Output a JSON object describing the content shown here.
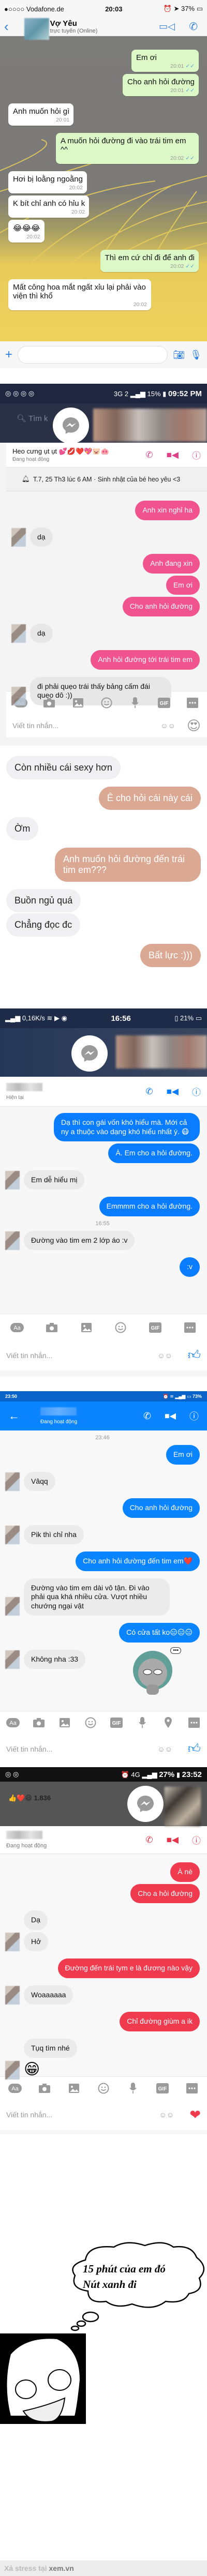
{
  "whatsapp": {
    "status": {
      "carrier": "●○○○○ Vodafone.de",
      "time": "20:03",
      "battery": "37%"
    },
    "contact": {
      "name": "Vợ Yêu",
      "status": "trực tuyến (Online)"
    },
    "messages": [
      {
        "side": "out",
        "text": "Em ơi",
        "time": "20:01"
      },
      {
        "side": "out",
        "text": "Cho anh hỏi đường",
        "time": "20:01"
      },
      {
        "side": "in",
        "text": "Anh muốn hỏi gì",
        "time": "20:01"
      },
      {
        "side": "out",
        "text": "A muốn hỏi đường đi vào trái tim em ^^",
        "time": "20:02"
      },
      {
        "side": "in",
        "text": "Hơi bị loằng ngoằng",
        "time": "20:02"
      },
      {
        "side": "in",
        "text": "K bít chỉ anh có hỉu k",
        "time": "20:02"
      },
      {
        "side": "in",
        "text": "😂😂😂",
        "time": "20:02"
      },
      {
        "side": "out",
        "text": "Thì em cứ chỉ đi để anh đi",
        "time": "20:02"
      },
      {
        "side": "in",
        "text": "Mất công hoa mắt ngất xỉu lại phải vào viện thì khổ",
        "time": "20:02"
      }
    ],
    "accent": "#dcf8c6"
  },
  "pink_chat": {
    "status": {
      "network": "3G 2",
      "battery": "15%",
      "time": "09:52 PM"
    },
    "contact": {
      "name": "Heo cưng ụt ụt 💕💋❤️💖🐷🐽",
      "status": "Đang hoạt động"
    },
    "search_placeholder": "Tìm k",
    "reminder": "T.7, 25 Th3 lúc 6 AM · Sinh nhật của bé heo yêu <3",
    "messages": [
      {
        "side": "out",
        "text": "Anh xin nghỉ ha"
      },
      {
        "side": "in",
        "text": "dạ"
      },
      {
        "side": "out",
        "text": "Anh đang xin"
      },
      {
        "side": "out",
        "text": "Em ơi"
      },
      {
        "side": "out",
        "text": "Cho anh hỏi đường"
      },
      {
        "side": "in",
        "text": "dạ"
      },
      {
        "side": "out",
        "text": "Anh hỏi đường tới trái tim em"
      },
      {
        "side": "in",
        "text": "đi phải quẹo trái thấy bảng cấm đái quẹo dô :))"
      }
    ],
    "toolbar": [
      "aa",
      "camera",
      "image",
      "smile",
      "mic",
      "gif",
      "more"
    ],
    "input_placeholder": "Viết tin nhắn...",
    "accent": "#f1538e"
  },
  "peach_chat": {
    "messages": [
      {
        "side": "in",
        "text": "Còn nhiều cái sexy hơn"
      },
      {
        "side": "out",
        "text": "Ê cho hỏi cái này cái"
      },
      {
        "side": "in",
        "text": "Ờm"
      },
      {
        "side": "out",
        "text": "Anh muốn hỏi đường đến trái tim em???"
      },
      {
        "side": "in",
        "text": "Buồn ngủ quá"
      },
      {
        "side": "in",
        "text": "Chẳng đọc đc"
      },
      {
        "side": "out",
        "text": "Bất lực :)))"
      }
    ],
    "accent": "#dba993"
  },
  "blue_chat": {
    "status": {
      "speed": "0,16K/s",
      "time": "16:56",
      "battery": "21%"
    },
    "contact": {
      "status": "Hiện tại"
    },
    "messages": [
      {
        "side": "out",
        "text": "Dạ thì con gái vốn khó hiểu mà. Mới cả ny a thuộc vào dạng khó hiểu nhất ý. 😷"
      },
      {
        "side": "out",
        "text": "À. Em cho a hỏi đường."
      },
      {
        "side": "in",
        "text": "Em dễ hiểu mị"
      },
      {
        "side": "out",
        "text": "Emmmm cho a hỏi đường."
      },
      {
        "stamp": "16:55"
      },
      {
        "side": "in",
        "text": "Đường vào tim em 2 lớp áo :v"
      },
      {
        "side": "out",
        "text": ":v"
      }
    ],
    "toolbar": [
      "aa",
      "camera",
      "image",
      "smile",
      "gif",
      "more"
    ],
    "input_placeholder": "Viết tin nhắn...",
    "accent": "#0a7cff"
  },
  "android_blue_chat": {
    "status": {
      "time": "23:50",
      "battery": "73%"
    },
    "contact": {
      "status": "Đang hoạt động"
    },
    "messages": [
      {
        "stamp": "23:46"
      },
      {
        "side": "out",
        "text": "Em ơi"
      },
      {
        "side": "in",
        "text": "Vâqq"
      },
      {
        "side": "out",
        "text": "Cho anh hỏi đường"
      },
      {
        "side": "in",
        "text": "Pik thì chỉ nha"
      },
      {
        "side": "out",
        "text": "Cho anh hỏi đường đến tim em❤️"
      },
      {
        "side": "in",
        "text": "Đường vào tim em dài vô tận. Đi vào phải qua khá nhiều cửa. Vượt nhiều chướng ngại vật"
      },
      {
        "side": "out",
        "text": "Có cửa tất ko😑😑😑"
      },
      {
        "side": "in",
        "text": "Không nha :33"
      }
    ],
    "sticker_bubble": "•••",
    "toolbar": [
      "aa",
      "camera",
      "image",
      "smile",
      "gif",
      "mic",
      "location",
      "more"
    ],
    "input_placeholder": "Viết tin nhắn...",
    "accent": "#0a84ff"
  },
  "red_chat": {
    "status": {
      "network": "4G",
      "battery": "27%",
      "time": "23:52"
    },
    "reactions_count": "1.836",
    "contact": {
      "status": "Đang hoạt động"
    },
    "messages": [
      {
        "side": "out",
        "text": "À nè"
      },
      {
        "side": "out",
        "text": "Cho a hỏi đường"
      },
      {
        "side": "in",
        "text": "Dạ"
      },
      {
        "side": "in",
        "text": "Hở"
      },
      {
        "side": "out",
        "text": "Đường đến trái tym e là đương nào vậy"
      },
      {
        "side": "in",
        "text": "Woaaaaaa"
      },
      {
        "side": "out",
        "text": "Chỉ đường giùm a ik"
      },
      {
        "side": "in",
        "text": "Tụq tìm nhé"
      },
      {
        "side": "in",
        "text": "😁",
        "emoji": true
      }
    ],
    "toolbar": [
      "aa",
      "camera",
      "image",
      "smile",
      "mic",
      "gif",
      "more"
    ],
    "input_placeholder": "Viết tin nhắn...",
    "accent": "#f03a4e"
  },
  "meme": {
    "thought_line1": "15 phút của em đó",
    "thought_line2": "Nút xanh đi"
  },
  "footer": {
    "text": "Xả stress tại",
    "brand": "xem.vn"
  }
}
